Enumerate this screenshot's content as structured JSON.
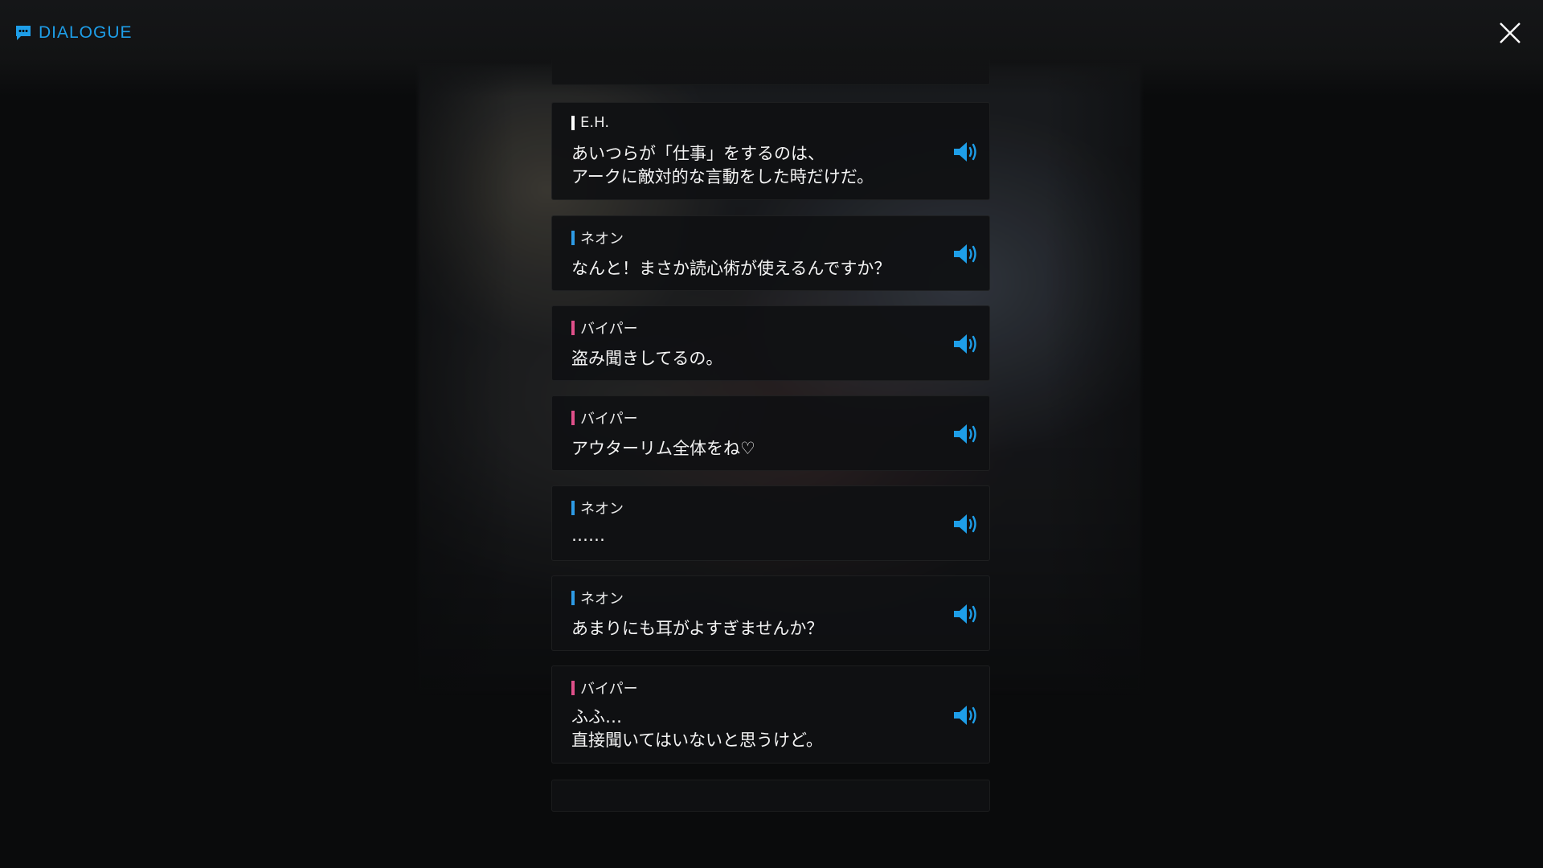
{
  "header": {
    "title": "DIALOGUE",
    "title_icon": "chat-bubble-icon",
    "close_icon": "close-icon"
  },
  "colors": {
    "accent": "#1e9ee8",
    "speaker_eh": "#ffffff",
    "speaker_neon": "#2e9be6",
    "speaker_viper": "#e0508a"
  },
  "voice_icon": "speaker-volume-icon",
  "entries": [
    {
      "speaker": "E.H.",
      "speaker_color": "#ffffff",
      "lines": [
        "あいつらが「仕事」をするのは、",
        "アークに敵対的な言動をした時だけだ。"
      ]
    },
    {
      "speaker": "ネオン",
      "speaker_color": "#2e9be6",
      "lines": [
        "なんと！まさか読心術が使えるんですか？"
      ]
    },
    {
      "speaker": "バイパー",
      "speaker_color": "#e0508a",
      "lines": [
        "盗み聞きしてるの。"
      ]
    },
    {
      "speaker": "バイパー",
      "speaker_color": "#e0508a",
      "lines": [
        "アウターリム全体をね♡"
      ]
    },
    {
      "speaker": "ネオン",
      "speaker_color": "#2e9be6",
      "lines": [
        "……"
      ]
    },
    {
      "speaker": "ネオン",
      "speaker_color": "#2e9be6",
      "lines": [
        "あまりにも耳がよすぎませんか？"
      ]
    },
    {
      "speaker": "バイパー",
      "speaker_color": "#e0508a",
      "lines": [
        "ふふ…",
        "直接聞いてはいないと思うけど。"
      ]
    }
  ]
}
